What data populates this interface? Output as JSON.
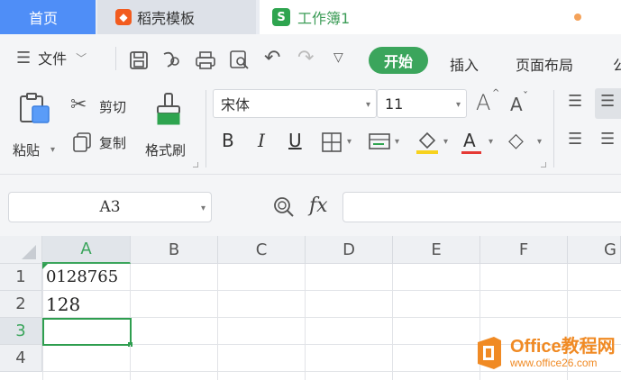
{
  "tabs": {
    "home": "首页",
    "docer": "稻壳模板",
    "workbook": "工作簿1",
    "workbook_logo": "S"
  },
  "menu": {
    "file": "文件",
    "start": "开始",
    "insert": "插入",
    "page_layout": "页面布局",
    "partial_next": "公"
  },
  "ribbon": {
    "paste": "粘贴",
    "cut": "剪切",
    "copy": "复制",
    "format_painter": "格式刷",
    "font_name": "宋体",
    "font_size": "11",
    "bold": "B",
    "italic": "I",
    "underline": "U",
    "font_color_letter": "A",
    "font_grow": "A",
    "font_shrink": "A"
  },
  "formula_bar": {
    "name_box": "A3",
    "fx": "fx",
    "value": ""
  },
  "sheet": {
    "columns": [
      "A",
      "B",
      "C",
      "D",
      "E",
      "F",
      "G"
    ],
    "rows": [
      "1",
      "2",
      "3",
      "4"
    ],
    "cells": {
      "A1": "0128765",
      "A2": "128",
      "A3": ""
    },
    "active_column": "A",
    "active_row": "3"
  },
  "watermark": {
    "title": "Office教程网",
    "url": "www.office26.com"
  },
  "colors": {
    "accent_green": "#3ba55c",
    "home_tab_blue": "#4f8ef7",
    "watermark_orange": "#f08a24"
  }
}
